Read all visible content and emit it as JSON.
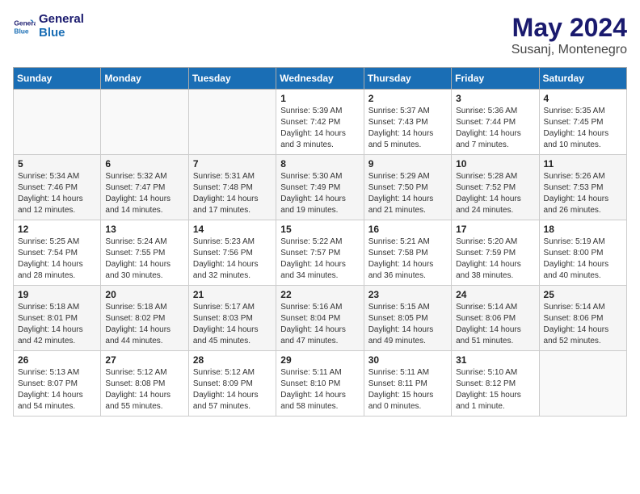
{
  "logo": {
    "line1": "General",
    "line2": "Blue"
  },
  "title": "May 2024",
  "location": "Susanj, Montenegro",
  "days_header": [
    "Sunday",
    "Monday",
    "Tuesday",
    "Wednesday",
    "Thursday",
    "Friday",
    "Saturday"
  ],
  "weeks": [
    [
      {
        "day": "",
        "sunrise": "",
        "sunset": "",
        "daylight": ""
      },
      {
        "day": "",
        "sunrise": "",
        "sunset": "",
        "daylight": ""
      },
      {
        "day": "",
        "sunrise": "",
        "sunset": "",
        "daylight": ""
      },
      {
        "day": "1",
        "sunrise": "Sunrise: 5:39 AM",
        "sunset": "Sunset: 7:42 PM",
        "daylight": "Daylight: 14 hours and 3 minutes."
      },
      {
        "day": "2",
        "sunrise": "Sunrise: 5:37 AM",
        "sunset": "Sunset: 7:43 PM",
        "daylight": "Daylight: 14 hours and 5 minutes."
      },
      {
        "day": "3",
        "sunrise": "Sunrise: 5:36 AM",
        "sunset": "Sunset: 7:44 PM",
        "daylight": "Daylight: 14 hours and 7 minutes."
      },
      {
        "day": "4",
        "sunrise": "Sunrise: 5:35 AM",
        "sunset": "Sunset: 7:45 PM",
        "daylight": "Daylight: 14 hours and 10 minutes."
      }
    ],
    [
      {
        "day": "5",
        "sunrise": "Sunrise: 5:34 AM",
        "sunset": "Sunset: 7:46 PM",
        "daylight": "Daylight: 14 hours and 12 minutes."
      },
      {
        "day": "6",
        "sunrise": "Sunrise: 5:32 AM",
        "sunset": "Sunset: 7:47 PM",
        "daylight": "Daylight: 14 hours and 14 minutes."
      },
      {
        "day": "7",
        "sunrise": "Sunrise: 5:31 AM",
        "sunset": "Sunset: 7:48 PM",
        "daylight": "Daylight: 14 hours and 17 minutes."
      },
      {
        "day": "8",
        "sunrise": "Sunrise: 5:30 AM",
        "sunset": "Sunset: 7:49 PM",
        "daylight": "Daylight: 14 hours and 19 minutes."
      },
      {
        "day": "9",
        "sunrise": "Sunrise: 5:29 AM",
        "sunset": "Sunset: 7:50 PM",
        "daylight": "Daylight: 14 hours and 21 minutes."
      },
      {
        "day": "10",
        "sunrise": "Sunrise: 5:28 AM",
        "sunset": "Sunset: 7:52 PM",
        "daylight": "Daylight: 14 hours and 24 minutes."
      },
      {
        "day": "11",
        "sunrise": "Sunrise: 5:26 AM",
        "sunset": "Sunset: 7:53 PM",
        "daylight": "Daylight: 14 hours and 26 minutes."
      }
    ],
    [
      {
        "day": "12",
        "sunrise": "Sunrise: 5:25 AM",
        "sunset": "Sunset: 7:54 PM",
        "daylight": "Daylight: 14 hours and 28 minutes."
      },
      {
        "day": "13",
        "sunrise": "Sunrise: 5:24 AM",
        "sunset": "Sunset: 7:55 PM",
        "daylight": "Daylight: 14 hours and 30 minutes."
      },
      {
        "day": "14",
        "sunrise": "Sunrise: 5:23 AM",
        "sunset": "Sunset: 7:56 PM",
        "daylight": "Daylight: 14 hours and 32 minutes."
      },
      {
        "day": "15",
        "sunrise": "Sunrise: 5:22 AM",
        "sunset": "Sunset: 7:57 PM",
        "daylight": "Daylight: 14 hours and 34 minutes."
      },
      {
        "day": "16",
        "sunrise": "Sunrise: 5:21 AM",
        "sunset": "Sunset: 7:58 PM",
        "daylight": "Daylight: 14 hours and 36 minutes."
      },
      {
        "day": "17",
        "sunrise": "Sunrise: 5:20 AM",
        "sunset": "Sunset: 7:59 PM",
        "daylight": "Daylight: 14 hours and 38 minutes."
      },
      {
        "day": "18",
        "sunrise": "Sunrise: 5:19 AM",
        "sunset": "Sunset: 8:00 PM",
        "daylight": "Daylight: 14 hours and 40 minutes."
      }
    ],
    [
      {
        "day": "19",
        "sunrise": "Sunrise: 5:18 AM",
        "sunset": "Sunset: 8:01 PM",
        "daylight": "Daylight: 14 hours and 42 minutes."
      },
      {
        "day": "20",
        "sunrise": "Sunrise: 5:18 AM",
        "sunset": "Sunset: 8:02 PM",
        "daylight": "Daylight: 14 hours and 44 minutes."
      },
      {
        "day": "21",
        "sunrise": "Sunrise: 5:17 AM",
        "sunset": "Sunset: 8:03 PM",
        "daylight": "Daylight: 14 hours and 45 minutes."
      },
      {
        "day": "22",
        "sunrise": "Sunrise: 5:16 AM",
        "sunset": "Sunset: 8:04 PM",
        "daylight": "Daylight: 14 hours and 47 minutes."
      },
      {
        "day": "23",
        "sunrise": "Sunrise: 5:15 AM",
        "sunset": "Sunset: 8:05 PM",
        "daylight": "Daylight: 14 hours and 49 minutes."
      },
      {
        "day": "24",
        "sunrise": "Sunrise: 5:14 AM",
        "sunset": "Sunset: 8:06 PM",
        "daylight": "Daylight: 14 hours and 51 minutes."
      },
      {
        "day": "25",
        "sunrise": "Sunrise: 5:14 AM",
        "sunset": "Sunset: 8:06 PM",
        "daylight": "Daylight: 14 hours and 52 minutes."
      }
    ],
    [
      {
        "day": "26",
        "sunrise": "Sunrise: 5:13 AM",
        "sunset": "Sunset: 8:07 PM",
        "daylight": "Daylight: 14 hours and 54 minutes."
      },
      {
        "day": "27",
        "sunrise": "Sunrise: 5:12 AM",
        "sunset": "Sunset: 8:08 PM",
        "daylight": "Daylight: 14 hours and 55 minutes."
      },
      {
        "day": "28",
        "sunrise": "Sunrise: 5:12 AM",
        "sunset": "Sunset: 8:09 PM",
        "daylight": "Daylight: 14 hours and 57 minutes."
      },
      {
        "day": "29",
        "sunrise": "Sunrise: 5:11 AM",
        "sunset": "Sunset: 8:10 PM",
        "daylight": "Daylight: 14 hours and 58 minutes."
      },
      {
        "day": "30",
        "sunrise": "Sunrise: 5:11 AM",
        "sunset": "Sunset: 8:11 PM",
        "daylight": "Daylight: 15 hours and 0 minutes."
      },
      {
        "day": "31",
        "sunrise": "Sunrise: 5:10 AM",
        "sunset": "Sunset: 8:12 PM",
        "daylight": "Daylight: 15 hours and 1 minute."
      },
      {
        "day": "",
        "sunrise": "",
        "sunset": "",
        "daylight": ""
      }
    ]
  ]
}
